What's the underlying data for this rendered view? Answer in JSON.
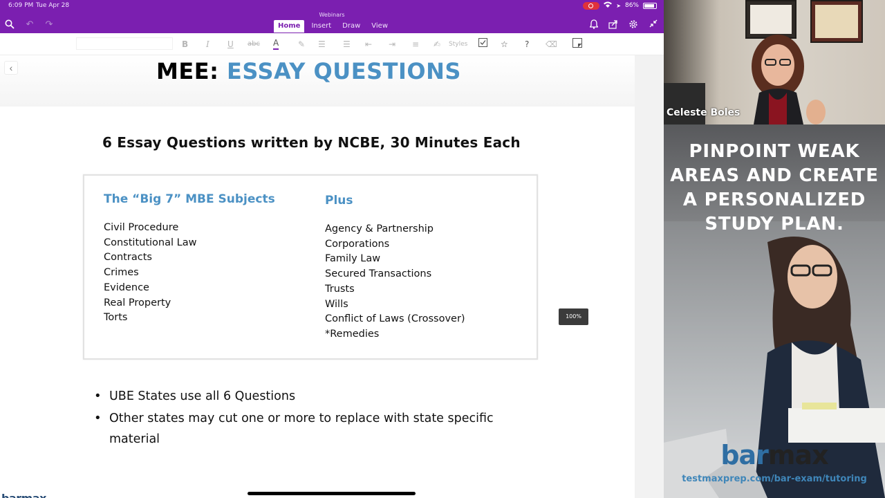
{
  "status": {
    "time": "6:09 PM",
    "date": "Tue Apr 28",
    "battery": "86%"
  },
  "app": {
    "title": "Webinars",
    "tabs": [
      {
        "label": "Home",
        "active": true
      },
      {
        "label": "Insert",
        "active": false
      },
      {
        "label": "Draw",
        "active": false
      },
      {
        "label": "View",
        "active": false
      }
    ]
  },
  "ribbon": {
    "styles_label": "Styles"
  },
  "slide": {
    "title_prefix": "MEE:",
    "title_main": "ESSAY QUESTIONS",
    "subtitle": "6 Essay Questions written by NCBE, 30 Minutes Each",
    "left_heading": "The “Big 7” MBE Subjects",
    "left_items": [
      "Civil Procedure",
      "Constitutional Law",
      "Contracts",
      "Crimes",
      "Evidence",
      "Real Property",
      "Torts"
    ],
    "right_heading": "Plus",
    "right_items": [
      "Agency & Partnership",
      "Corporations",
      "Family Law",
      "Secured Transactions",
      "Trusts",
      "Wills",
      "Conflict of Laws (Crossover)",
      "*Remedies"
    ],
    "bullets": [
      "UBE States use all 6 Questions",
      "Other states may cut one or more to replace with state specific material"
    ]
  },
  "zoom": "100%",
  "webcam": {
    "presenter_name": "Celeste Boles"
  },
  "ad": {
    "headline_lines": [
      "PINPOINT WEAK",
      "AREAS AND CREATE",
      "A PERSONALIZED",
      "STUDY PLAN."
    ],
    "logo_bar": "bar",
    "logo_max": "max",
    "url": "testmaxprep.com/bar-exam/tutoring"
  },
  "colors": {
    "toolbar": "#7b1fb0",
    "accent_blue": "#4b91c4",
    "url_blue": "#3f86b9"
  }
}
